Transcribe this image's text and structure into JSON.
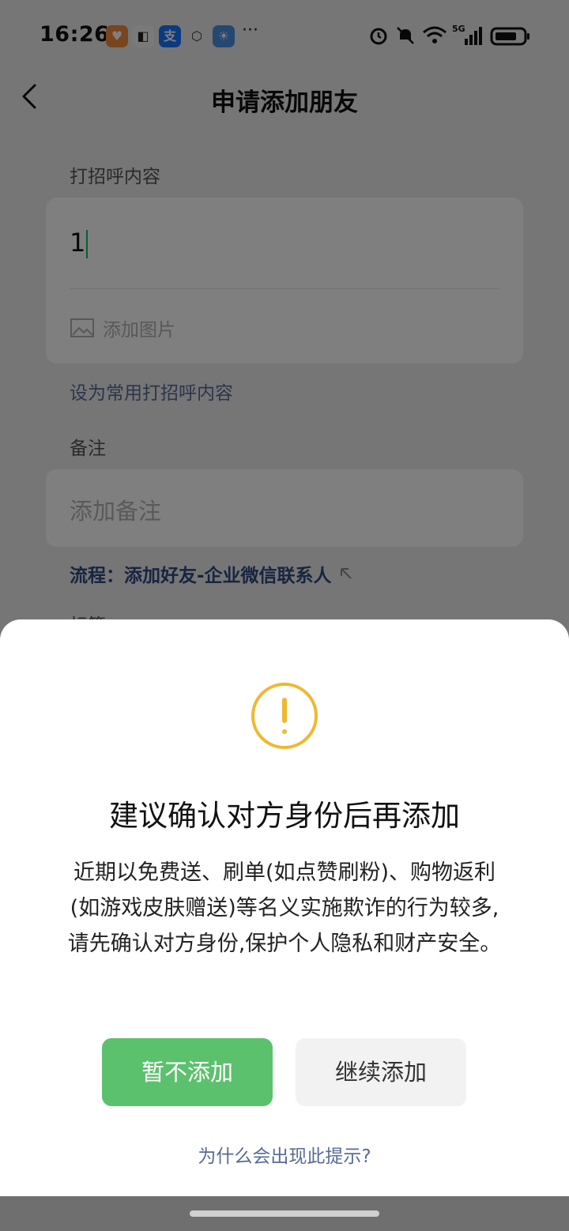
{
  "status_bar": {
    "time": "16:26",
    "app_icons": [
      "health-app-icon",
      "app-icon-2",
      "alipay-icon",
      "shield-app-icon",
      "weather-app-icon"
    ],
    "more": "···",
    "network": "5G"
  },
  "nav": {
    "title": "申请添加朋友"
  },
  "form": {
    "greeting_label": "打招呼内容",
    "greeting_value": "1",
    "add_image": "添加图片",
    "set_common": "设为常用打招呼内容",
    "remark_label": "备注",
    "remark_placeholder": "添加备注",
    "process_text": "流程：添加好友-企业微信联系人",
    "tag_label": "标签"
  },
  "dialog": {
    "title": "建议确认对方身份后再添加",
    "body_line1": "近期以免费送、刷单(如点赞刷粉)、购物返利",
    "body_line2": "(如游戏皮肤赠送)等名义实施欺诈的行为较多,",
    "body_line3": "请先确认对方身份,保护个人隐私和财产安全。",
    "primary_button": "暂不添加",
    "secondary_button": "继续添加",
    "why_link": "为什么会出现此提示?"
  },
  "colors": {
    "primary": "#5cc16d",
    "link": "#576b95",
    "warning": "#f0b830"
  }
}
